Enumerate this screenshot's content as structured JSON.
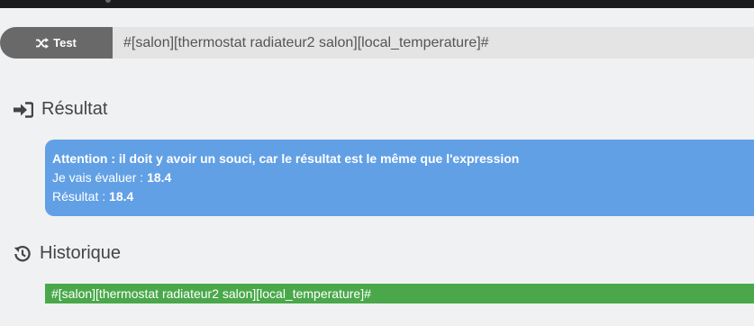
{
  "toolbar": {
    "test_button_label": "Test",
    "expression_value": "#[salon][thermostat radiateur2 salon][local_temperature]#"
  },
  "result": {
    "title": "Résultat",
    "warning": "Attention : il doit y avoir un souci, car le résultat est le même que l'expression",
    "evaluate_label": "Je vais évaluer : ",
    "evaluate_value": "18.4",
    "result_label": "Résultat : ",
    "result_value": "18.4"
  },
  "history": {
    "title": "Historique",
    "items": [
      "#[salon][thermostat radiateur2 salon][local_temperature]#"
    ]
  },
  "colors": {
    "result_bg": "#62a0e6",
    "history_item_bg": "#4aa84b",
    "button_bg": "#696969"
  },
  "icons": {
    "test": "shuffle-icon",
    "result": "sign-in-icon",
    "history": "history-icon"
  }
}
